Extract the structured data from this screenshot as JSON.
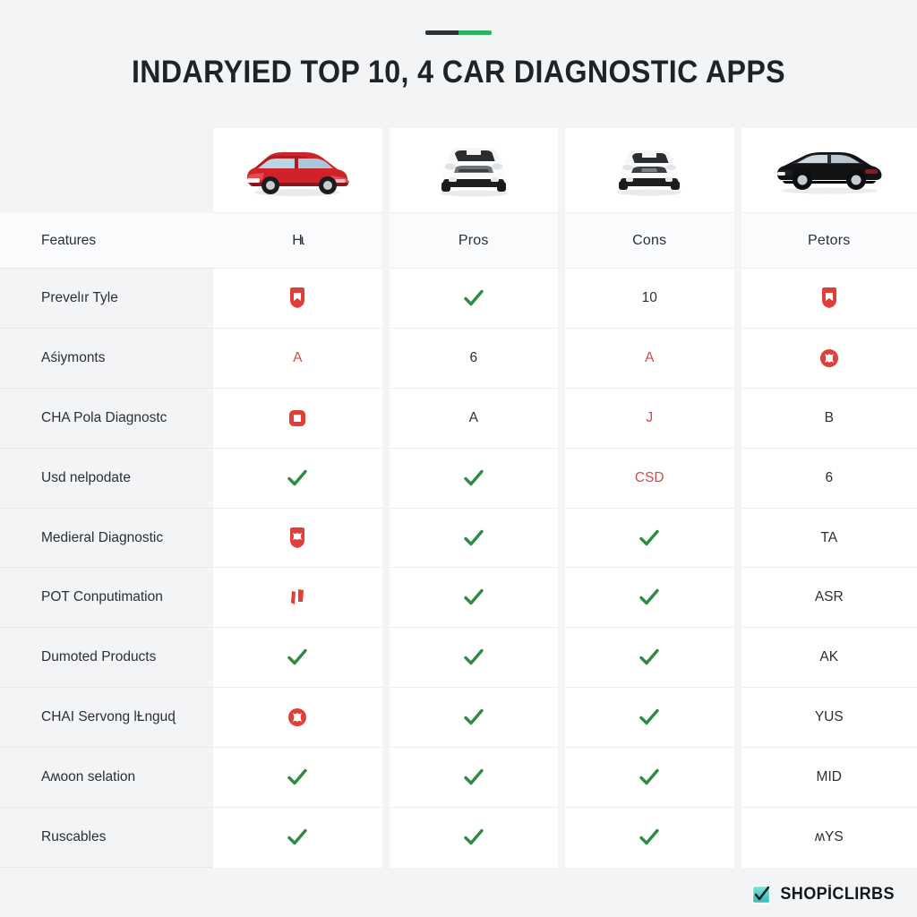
{
  "title": {
    "text": "INDARYIED TOP 10, 4 CAR DIAGNOSTIC APPS",
    "divider_dark": "#2f3337",
    "divider_green": "#2eb25f"
  },
  "colors": {
    "background": "#f3f4f6",
    "card": "#ffffff",
    "text": "#2b2f33",
    "check_green": "#2f8a43",
    "badge_red": "#e03e3a",
    "muted_red": "#d14b49",
    "watermark_teal": "#4ecdc4"
  },
  "table": {
    "feature_header": "Features",
    "columns": [
      {
        "header": "Hɩ",
        "image": "red-hatchback-car"
      },
      {
        "header": "Pros",
        "image": "white-suv-car"
      },
      {
        "header": "Cons",
        "image": "white-sedan-car"
      },
      {
        "header": "Petors",
        "image": "black-sedan-car"
      }
    ],
    "rows": [
      {
        "label": "Prevelır Tyle",
        "cells": [
          {
            "kind": "badge-shield"
          },
          {
            "kind": "check"
          },
          {
            "kind": "text",
            "value": "10"
          },
          {
            "kind": "badge-shield"
          }
        ]
      },
      {
        "label": "Aśiymonts",
        "cells": [
          {
            "kind": "text",
            "value": "A",
            "style": "red"
          },
          {
            "kind": "text",
            "value": "6"
          },
          {
            "kind": "text",
            "value": "A",
            "style": "red"
          },
          {
            "kind": "badge-circle"
          }
        ]
      },
      {
        "label": "CHA Pola Diagnostc",
        "cells": [
          {
            "kind": "badge-square"
          },
          {
            "kind": "text",
            "value": "A"
          },
          {
            "kind": "text",
            "value": "J",
            "style": "red"
          },
          {
            "kind": "text",
            "value": "B"
          }
        ]
      },
      {
        "label": "Usd nelpodate",
        "cells": [
          {
            "kind": "check"
          },
          {
            "kind": "check"
          },
          {
            "kind": "text",
            "value": "CSD",
            "style": "red"
          },
          {
            "kind": "text",
            "value": "6"
          }
        ]
      },
      {
        "label": "Medieral Diagnostic",
        "cells": [
          {
            "kind": "badge-shield"
          },
          {
            "kind": "check"
          },
          {
            "kind": "check"
          },
          {
            "kind": "text",
            "value": "TA"
          }
        ]
      },
      {
        "label": "POT Conputimation",
        "cells": [
          {
            "kind": "bars"
          },
          {
            "kind": "check"
          },
          {
            "kind": "check"
          },
          {
            "kind": "text",
            "value": "ASR"
          }
        ]
      },
      {
        "label": "Dumoted Products",
        "cells": [
          {
            "kind": "check"
          },
          {
            "kind": "check"
          },
          {
            "kind": "check"
          },
          {
            "kind": "text",
            "value": "AK"
          }
        ]
      },
      {
        "label": "CHAI Servong lȽnguɖ",
        "cells": [
          {
            "kind": "badge-circle"
          },
          {
            "kind": "check"
          },
          {
            "kind": "check"
          },
          {
            "kind": "text",
            "value": "YUS"
          }
        ]
      },
      {
        "label": "Aʍoon selation",
        "cells": [
          {
            "kind": "check"
          },
          {
            "kind": "check"
          },
          {
            "kind": "check"
          },
          {
            "kind": "text",
            "value": "MID"
          }
        ]
      },
      {
        "label": "Ruscables",
        "cells": [
          {
            "kind": "check"
          },
          {
            "kind": "check"
          },
          {
            "kind": "check"
          },
          {
            "kind": "text",
            "value": "ʍYS"
          }
        ]
      }
    ]
  },
  "watermark": {
    "text": "SHOPİCLIRBS",
    "icon": "checkbox-icon"
  }
}
